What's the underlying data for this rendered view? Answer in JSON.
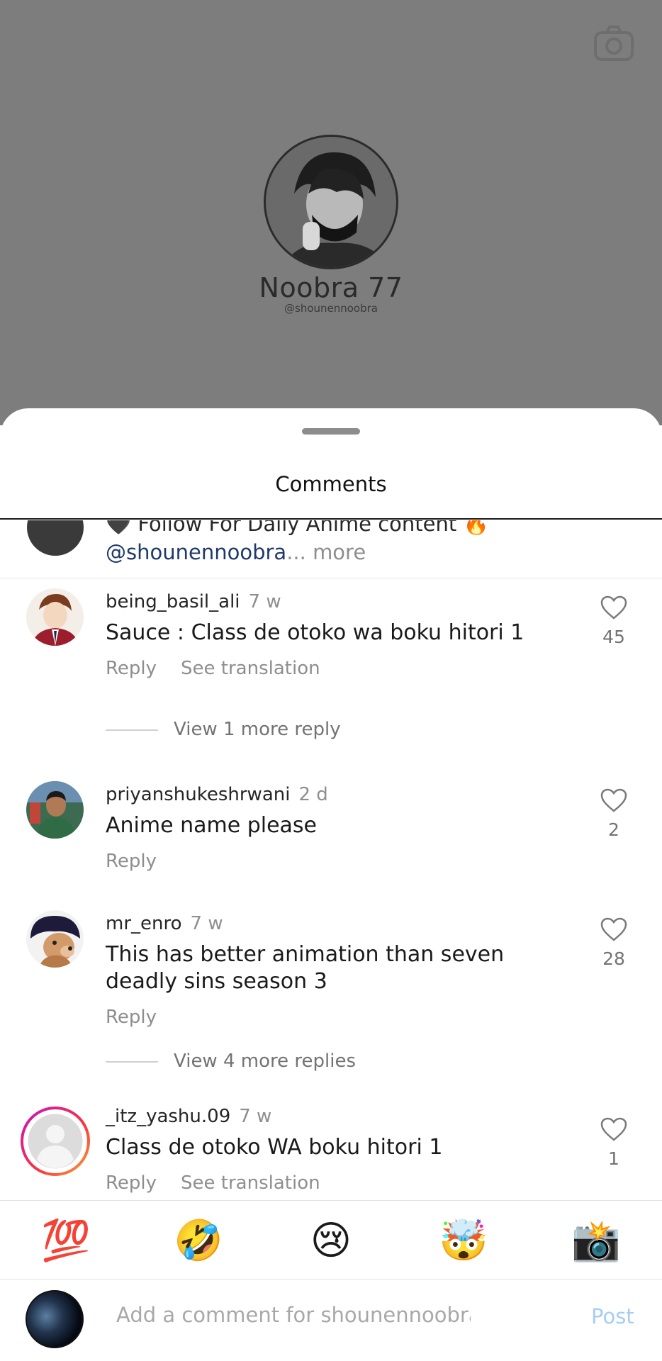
{
  "background": {
    "profile_name": "Noobra 77",
    "profile_handle": "@shounennoobra",
    "camera_icon": "camera-icon"
  },
  "sheet": {
    "title": "Comments",
    "caption": {
      "text": "🖤 Follow For Daily Anime content 🔥",
      "mention": "@shounennoobra",
      "ellipsis": "...",
      "more": "more"
    }
  },
  "comments": [
    {
      "username": "being_basil_ali",
      "time": "7 w",
      "text": "Sauce : Class de otoko wa boku hitori 1",
      "reply": "Reply",
      "translate": "See translation",
      "likes": "45"
    },
    {
      "username": "priyanshukeshrwani",
      "time": "2 d",
      "text": "Anime name please",
      "reply": "Reply",
      "likes": "2"
    },
    {
      "username": "mr_enro",
      "time": "7 w",
      "text": "This has better animation than seven deadly sins season 3",
      "reply": "Reply",
      "likes": "28"
    },
    {
      "username": "_itz_yashu.09",
      "time": "7 w",
      "text": "Class de otoko WA boku hitori 1",
      "reply": "Reply",
      "translate": "See translation",
      "likes": "1"
    }
  ],
  "view_replies": [
    "View 1 more reply",
    "View 4 more replies"
  ],
  "emoji_bar": [
    "💯",
    "🤣",
    "😢",
    "🤯",
    "📸"
  ],
  "input": {
    "placeholder": "Add a comment for shounennoobra...",
    "post_label": "Post"
  },
  "colors": {
    "mention": "#1e3a6b",
    "post_disabled": "#a6cdf5",
    "story_ring_start": "#c913b9",
    "story_ring_end": "#f9a033"
  }
}
